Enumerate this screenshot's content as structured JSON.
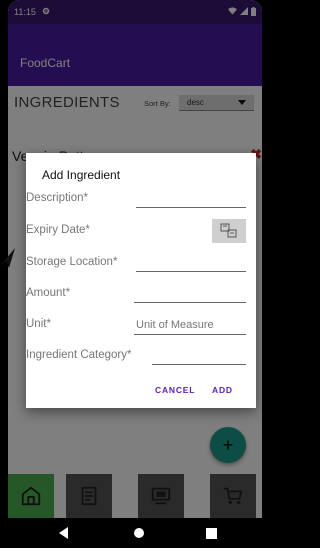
{
  "status_bar": {
    "time": "11:15"
  },
  "app_bar": {
    "title": "FoodCart"
  },
  "page": {
    "title": "INGREDIENTS",
    "sort_label": "Sort By:",
    "sort_value": "desc",
    "list_item_partial": "Veggie Patty"
  },
  "dialog": {
    "title": "Add Ingredient",
    "fields": {
      "description": {
        "label": "Description*",
        "value": ""
      },
      "expiry_date": {
        "label": "Expiry Date*",
        "value": ""
      },
      "storage_location": {
        "label": "Storage Location*",
        "value": ""
      },
      "amount": {
        "label": "Amount*",
        "value": ""
      },
      "unit": {
        "label": "Unit*",
        "placeholder": "Unit of Measure"
      },
      "category": {
        "label": "Ingredient Category*",
        "value": ""
      }
    },
    "cancel_label": "CANCEL",
    "add_label": "ADD"
  },
  "fab": {
    "icon": "plus-icon",
    "label": "+"
  },
  "bottom_nav": {
    "tabs": [
      {
        "icon": "home-icon",
        "active": true
      },
      {
        "icon": "receipt-icon",
        "active": false
      },
      {
        "icon": "inventory-icon",
        "active": false
      },
      {
        "icon": "cart-icon",
        "active": false
      }
    ]
  },
  "colors": {
    "primary": "#4b1ba3",
    "status_bar": "#3a1670",
    "accent": "#1a9a8a",
    "active_tab": "#4caf50",
    "dialog_button": "#5b21b6"
  }
}
